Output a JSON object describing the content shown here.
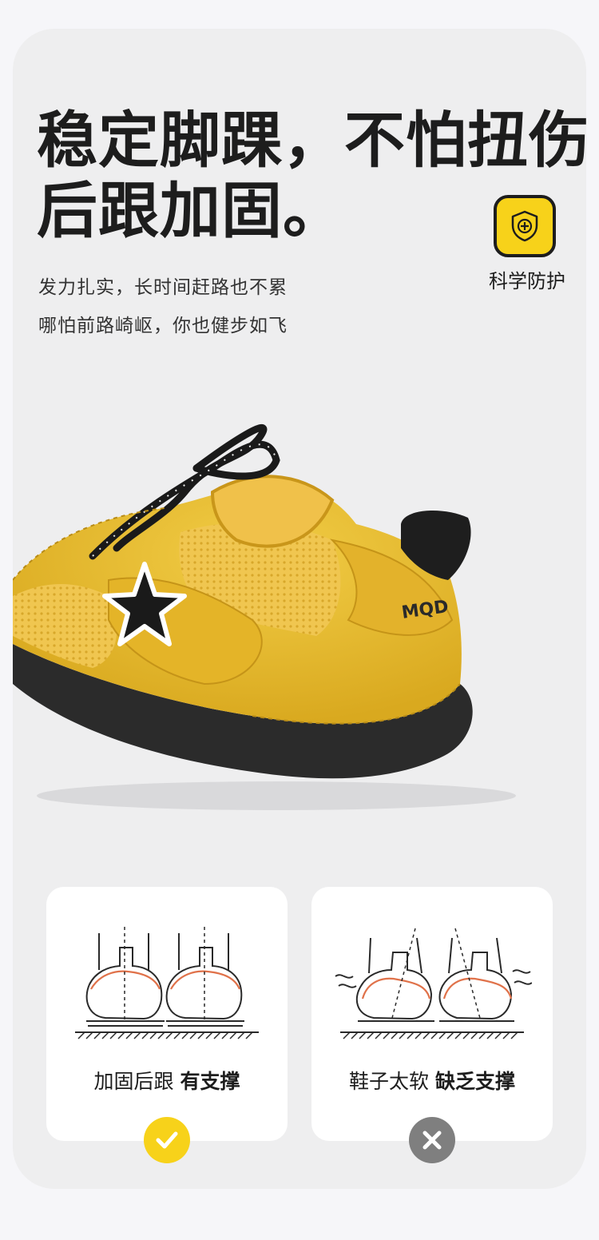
{
  "headline": {
    "line1": "稳定脚踝，不怕扭伤",
    "line2": "后跟加固。"
  },
  "subtext": {
    "line1": "发力扎实，长时间赶路也不累",
    "line2": "哪怕前路崎岖，你也健步如飞"
  },
  "badge": {
    "icon": "shield-plus-icon",
    "label": "科学防护"
  },
  "shoe": {
    "brand_mark": "MQD",
    "color": "#e8bd2a",
    "sole_color": "#2b2b2b"
  },
  "comparison": {
    "good": {
      "label_plain": "加固后跟",
      "label_bold": "有支撑",
      "status_icon": "checkmark-icon"
    },
    "bad": {
      "label_plain": "鞋子太软",
      "label_bold": "缺乏支撑",
      "status_icon": "cross-icon"
    }
  },
  "colors": {
    "accent": "#f7d21a",
    "text": "#1d1d1d",
    "card": "#eeeeef",
    "outline_red": "#e0724a",
    "neutral": "#7f7f7f"
  }
}
